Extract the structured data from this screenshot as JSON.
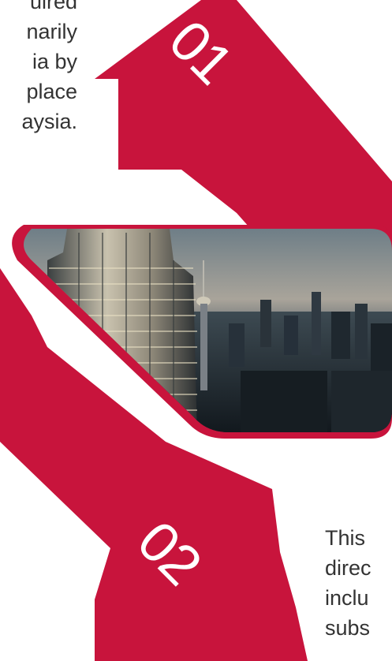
{
  "colors": {
    "accent": "#c8143c",
    "text": "#333333",
    "number": "#ffffff"
  },
  "steps": [
    {
      "number": "01"
    },
    {
      "number": "02"
    }
  ],
  "text_top": {
    "lines": [
      "uired",
      "narily",
      "ia by",
      "place",
      "aysia."
    ]
  },
  "text_bottom": {
    "lines": [
      "This",
      "direc",
      "inclu",
      "subs"
    ]
  },
  "photo": {
    "alt": "Kuala Lumpur skyline at dusk with Petronas tower and KL Tower"
  }
}
